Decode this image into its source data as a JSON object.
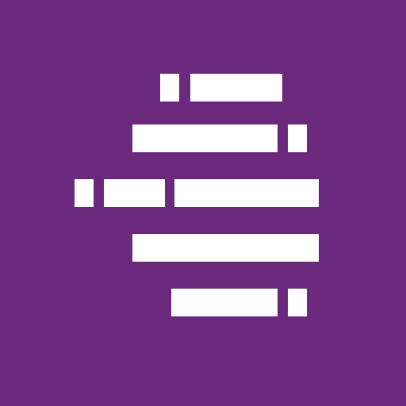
{
  "colors": {
    "background": "#6a297c",
    "bar": "#ffffff"
  },
  "icon": {
    "name": "code-lines-logo-icon"
  }
}
